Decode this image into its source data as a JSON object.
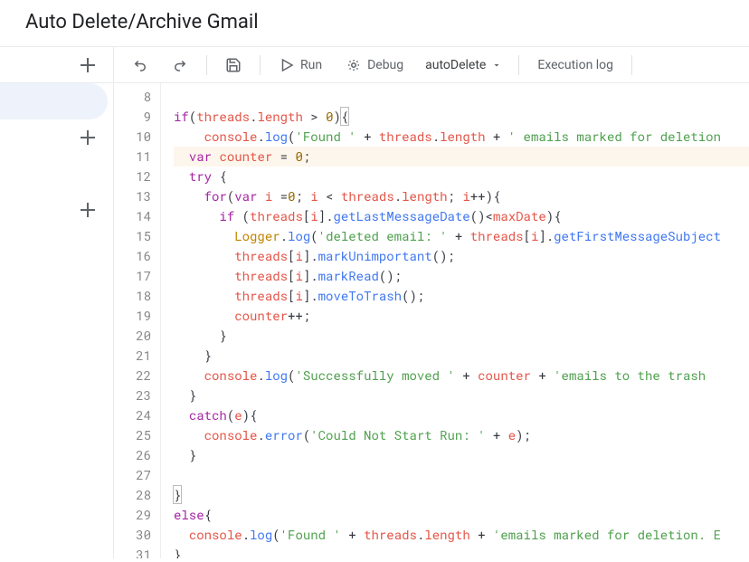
{
  "header": {
    "title": "Auto Delete/Archive Gmail"
  },
  "toolbar": {
    "run_label": "Run",
    "debug_label": "Debug",
    "function_selected": "autoDelete",
    "exec_log_label": "Execution log"
  },
  "editor": {
    "first_line_number": 8,
    "highlight_index": 3,
    "lines": [
      [],
      [
        {
          "t": "kw",
          "v": "if"
        },
        {
          "t": "par",
          "v": "("
        },
        {
          "t": "id",
          "v": "threads"
        },
        {
          "t": "op",
          "v": "."
        },
        {
          "t": "id",
          "v": "length"
        },
        {
          "t": "op",
          "v": " > "
        },
        {
          "t": "num",
          "v": "0"
        },
        {
          "t": "par",
          "v": ")"
        },
        {
          "t": "brm",
          "v": "{"
        }
      ],
      [
        {
          "t": "sp",
          "v": "    "
        },
        {
          "t": "id",
          "v": "console"
        },
        {
          "t": "op",
          "v": "."
        },
        {
          "t": "fn",
          "v": "log"
        },
        {
          "t": "par",
          "v": "("
        },
        {
          "t": "str",
          "v": "'Found '"
        },
        {
          "t": "op",
          "v": " + "
        },
        {
          "t": "id",
          "v": "threads"
        },
        {
          "t": "op",
          "v": "."
        },
        {
          "t": "id",
          "v": "length"
        },
        {
          "t": "op",
          "v": " + "
        },
        {
          "t": "str",
          "v": "' emails marked for deletion"
        }
      ],
      [
        {
          "t": "sp",
          "v": "  "
        },
        {
          "t": "kw",
          "v": "var"
        },
        {
          "t": "op",
          "v": " "
        },
        {
          "t": "id",
          "v": "counter"
        },
        {
          "t": "op",
          "v": " = "
        },
        {
          "t": "num",
          "v": "0"
        },
        {
          "t": "op",
          "v": ";"
        }
      ],
      [
        {
          "t": "sp",
          "v": "  "
        },
        {
          "t": "kw",
          "v": "try"
        },
        {
          "t": "op",
          "v": " {"
        }
      ],
      [
        {
          "t": "sp",
          "v": "    "
        },
        {
          "t": "kw",
          "v": "for"
        },
        {
          "t": "par",
          "v": "("
        },
        {
          "t": "kw",
          "v": "var"
        },
        {
          "t": "op",
          "v": " "
        },
        {
          "t": "id",
          "v": "i"
        },
        {
          "t": "op",
          "v": " ="
        },
        {
          "t": "num",
          "v": "0"
        },
        {
          "t": "op",
          "v": "; "
        },
        {
          "t": "id",
          "v": "i"
        },
        {
          "t": "op",
          "v": " < "
        },
        {
          "t": "id",
          "v": "threads"
        },
        {
          "t": "op",
          "v": "."
        },
        {
          "t": "id",
          "v": "length"
        },
        {
          "t": "op",
          "v": "; "
        },
        {
          "t": "id",
          "v": "i"
        },
        {
          "t": "op",
          "v": "++"
        },
        {
          "t": "par",
          "v": ")"
        },
        {
          "t": "op",
          "v": "{"
        }
      ],
      [
        {
          "t": "sp",
          "v": "      "
        },
        {
          "t": "kw",
          "v": "if"
        },
        {
          "t": "op",
          "v": " "
        },
        {
          "t": "par",
          "v": "("
        },
        {
          "t": "id",
          "v": "threads"
        },
        {
          "t": "par",
          "v": "["
        },
        {
          "t": "id",
          "v": "i"
        },
        {
          "t": "par",
          "v": "]"
        },
        {
          "t": "op",
          "v": "."
        },
        {
          "t": "fn",
          "v": "getLastMessageDate"
        },
        {
          "t": "par",
          "v": "()"
        },
        {
          "t": "op",
          "v": "<"
        },
        {
          "t": "id",
          "v": "maxDate"
        },
        {
          "t": "par",
          "v": ")"
        },
        {
          "t": "op",
          "v": "{"
        }
      ],
      [
        {
          "t": "sp",
          "v": "        "
        },
        {
          "t": "obj",
          "v": "Logger"
        },
        {
          "t": "op",
          "v": "."
        },
        {
          "t": "fn",
          "v": "log"
        },
        {
          "t": "par",
          "v": "("
        },
        {
          "t": "str",
          "v": "'deleted email: '"
        },
        {
          "t": "op",
          "v": " + "
        },
        {
          "t": "id",
          "v": "threads"
        },
        {
          "t": "par",
          "v": "["
        },
        {
          "t": "id",
          "v": "i"
        },
        {
          "t": "par",
          "v": "]"
        },
        {
          "t": "op",
          "v": "."
        },
        {
          "t": "fn",
          "v": "getFirstMessageSubject"
        }
      ],
      [
        {
          "t": "sp",
          "v": "        "
        },
        {
          "t": "id",
          "v": "threads"
        },
        {
          "t": "par",
          "v": "["
        },
        {
          "t": "id",
          "v": "i"
        },
        {
          "t": "par",
          "v": "]"
        },
        {
          "t": "op",
          "v": "."
        },
        {
          "t": "fn",
          "v": "markUnimportant"
        },
        {
          "t": "par",
          "v": "()"
        },
        {
          "t": "op",
          "v": ";"
        }
      ],
      [
        {
          "t": "sp",
          "v": "        "
        },
        {
          "t": "id",
          "v": "threads"
        },
        {
          "t": "par",
          "v": "["
        },
        {
          "t": "id",
          "v": "i"
        },
        {
          "t": "par",
          "v": "]"
        },
        {
          "t": "op",
          "v": "."
        },
        {
          "t": "fn",
          "v": "markRead"
        },
        {
          "t": "par",
          "v": "()"
        },
        {
          "t": "op",
          "v": ";"
        }
      ],
      [
        {
          "t": "sp",
          "v": "        "
        },
        {
          "t": "id",
          "v": "threads"
        },
        {
          "t": "par",
          "v": "["
        },
        {
          "t": "id",
          "v": "i"
        },
        {
          "t": "par",
          "v": "]"
        },
        {
          "t": "op",
          "v": "."
        },
        {
          "t": "fn",
          "v": "moveToTrash"
        },
        {
          "t": "par",
          "v": "()"
        },
        {
          "t": "op",
          "v": ";"
        }
      ],
      [
        {
          "t": "sp",
          "v": "        "
        },
        {
          "t": "id",
          "v": "counter"
        },
        {
          "t": "op",
          "v": "++;"
        }
      ],
      [
        {
          "t": "sp",
          "v": "      "
        },
        {
          "t": "op",
          "v": "}"
        }
      ],
      [
        {
          "t": "sp",
          "v": "    "
        },
        {
          "t": "op",
          "v": "}"
        }
      ],
      [
        {
          "t": "sp",
          "v": "    "
        },
        {
          "t": "id",
          "v": "console"
        },
        {
          "t": "op",
          "v": "."
        },
        {
          "t": "fn",
          "v": "log"
        },
        {
          "t": "par",
          "v": "("
        },
        {
          "t": "str",
          "v": "'Successfully moved '"
        },
        {
          "t": "op",
          "v": " + "
        },
        {
          "t": "id",
          "v": "counter"
        },
        {
          "t": "op",
          "v": " + "
        },
        {
          "t": "str",
          "v": "'emails to the trash"
        }
      ],
      [
        {
          "t": "sp",
          "v": "  "
        },
        {
          "t": "op",
          "v": "}"
        }
      ],
      [
        {
          "t": "sp",
          "v": "  "
        },
        {
          "t": "kw",
          "v": "catch"
        },
        {
          "t": "par",
          "v": "("
        },
        {
          "t": "id",
          "v": "e"
        },
        {
          "t": "par",
          "v": ")"
        },
        {
          "t": "op",
          "v": "{"
        }
      ],
      [
        {
          "t": "sp",
          "v": "    "
        },
        {
          "t": "id",
          "v": "console"
        },
        {
          "t": "op",
          "v": "."
        },
        {
          "t": "fn",
          "v": "error"
        },
        {
          "t": "par",
          "v": "("
        },
        {
          "t": "str",
          "v": "'Could Not Start Run: '"
        },
        {
          "t": "op",
          "v": " + "
        },
        {
          "t": "id",
          "v": "e"
        },
        {
          "t": "par",
          "v": ")"
        },
        {
          "t": "op",
          "v": ";"
        }
      ],
      [
        {
          "t": "sp",
          "v": "  "
        },
        {
          "t": "op",
          "v": "}"
        }
      ],
      [],
      [
        {
          "t": "brm",
          "v": "}"
        }
      ],
      [
        {
          "t": "kw",
          "v": "else"
        },
        {
          "t": "op",
          "v": "{"
        }
      ],
      [
        {
          "t": "sp",
          "v": "  "
        },
        {
          "t": "id",
          "v": "console"
        },
        {
          "t": "op",
          "v": "."
        },
        {
          "t": "fn",
          "v": "log"
        },
        {
          "t": "par",
          "v": "("
        },
        {
          "t": "str",
          "v": "'Found '"
        },
        {
          "t": "op",
          "v": " + "
        },
        {
          "t": "id",
          "v": "threads"
        },
        {
          "t": "op",
          "v": "."
        },
        {
          "t": "id",
          "v": "length"
        },
        {
          "t": "op",
          "v": " + "
        },
        {
          "t": "str",
          "v": "'emails marked for deletion. E"
        }
      ],
      [
        {
          "t": "op",
          "v": "}"
        }
      ]
    ]
  }
}
